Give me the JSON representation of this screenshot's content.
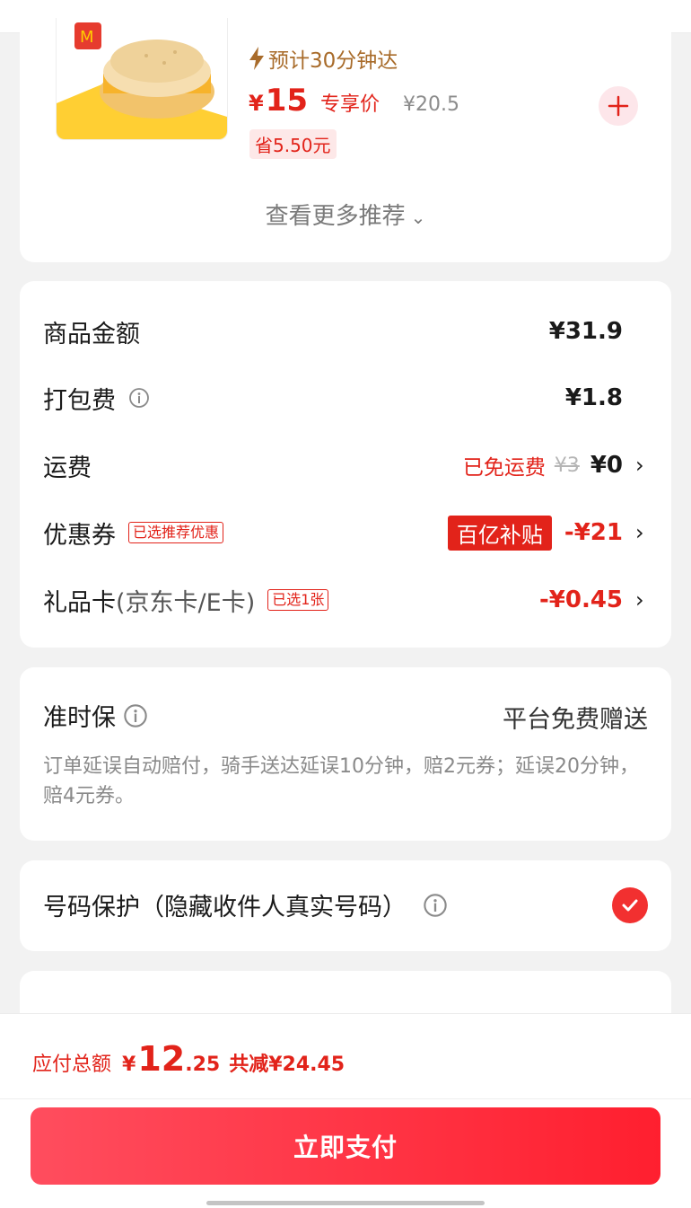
{
  "product": {
    "eta": "预计30分钟达",
    "price_symbol": "¥",
    "price": "15",
    "price_tag": "专享价",
    "original_price": "¥20.5",
    "save_badge": "省5.50元",
    "more_recommend": "查看更多推荐"
  },
  "summary": {
    "goods_label": "商品金额",
    "goods_value": "¥31.9",
    "packing_label": "打包费",
    "packing_value": "¥1.8",
    "shipping_label": "运费",
    "shipping_free": "已免运费",
    "shipping_original": "¥3",
    "shipping_value": "¥0",
    "coupon_label": "优惠券",
    "coupon_tag": "已选推荐优惠",
    "coupon_subsidy": "百亿补贴",
    "coupon_value": "-¥21",
    "giftcard_label": "礼品卡",
    "giftcard_sub": "(京东卡/E卡)",
    "giftcard_tag": "已选1张",
    "giftcard_value": "-¥0.45"
  },
  "ontime": {
    "title": "准时保",
    "right": "平台免费赠送",
    "desc": "订单延误自动赔付，骑手送达延误10分钟，赔2元券；延误20分钟，赔4元券。"
  },
  "privacy": {
    "label": "号码保护（隐藏收件人真实号码）",
    "checked": true
  },
  "footer": {
    "total_label": "应付总额",
    "total_symbol": "¥",
    "total_int": "12",
    "total_dec": ".25",
    "total_reduce": "共减¥24.45",
    "pay_button": "立即支付"
  },
  "colors": {
    "accent": "#e2231a",
    "pay_gradient_start": "#ff4d5e",
    "pay_gradient_end": "#ff1f2f",
    "eta": "#a86b2a"
  },
  "icons": {
    "eta": "lightning-icon",
    "add": "plus-icon",
    "info": "info-icon",
    "chevron": "chevron-right-icon",
    "check": "check-icon"
  }
}
